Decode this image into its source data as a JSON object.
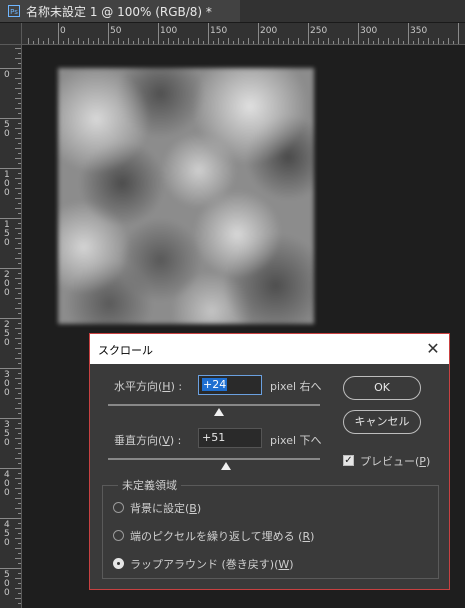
{
  "tab": {
    "icon": "ps-file-icon",
    "icon_text": "Ps",
    "title": "名称未設定 1 @ 100% (RGB/8) *"
  },
  "ruler": {
    "h_labels": [
      "0",
      "50",
      "100",
      "150",
      "200",
      "250",
      "300",
      "350"
    ],
    "v_labels": [
      "0",
      "50",
      "100",
      "150",
      "200",
      "250",
      "300",
      "350",
      "400",
      "450",
      "500"
    ]
  },
  "dialog": {
    "title": "スクロール",
    "close_icon": "close-icon",
    "horizontal": {
      "label": "水平方向(",
      "key": "H",
      "label_end": ") :",
      "value": "+24",
      "unit": "pixel 右へ"
    },
    "vertical": {
      "label": "垂直方向(",
      "key": "V",
      "label_end": ") :",
      "value": "+51",
      "unit": "pixel 下へ"
    },
    "ok": "OK",
    "cancel": "キャンセル",
    "preview": {
      "label": "プレビュー(",
      "key": "P",
      "label_end": ")",
      "checked": true
    },
    "undefined_area": {
      "legend": "未定義領域",
      "options": [
        {
          "label": "背景に設定(",
          "key": "B",
          "label_end": ")",
          "selected": false
        },
        {
          "label": "端のピクセルを繰り返して埋める (",
          "key": "R",
          "label_end": ")",
          "selected": false
        },
        {
          "label": "ラップアラウンド (巻き戻す)(",
          "key": "W",
          "label_end": ")",
          "selected": true
        }
      ]
    }
  }
}
